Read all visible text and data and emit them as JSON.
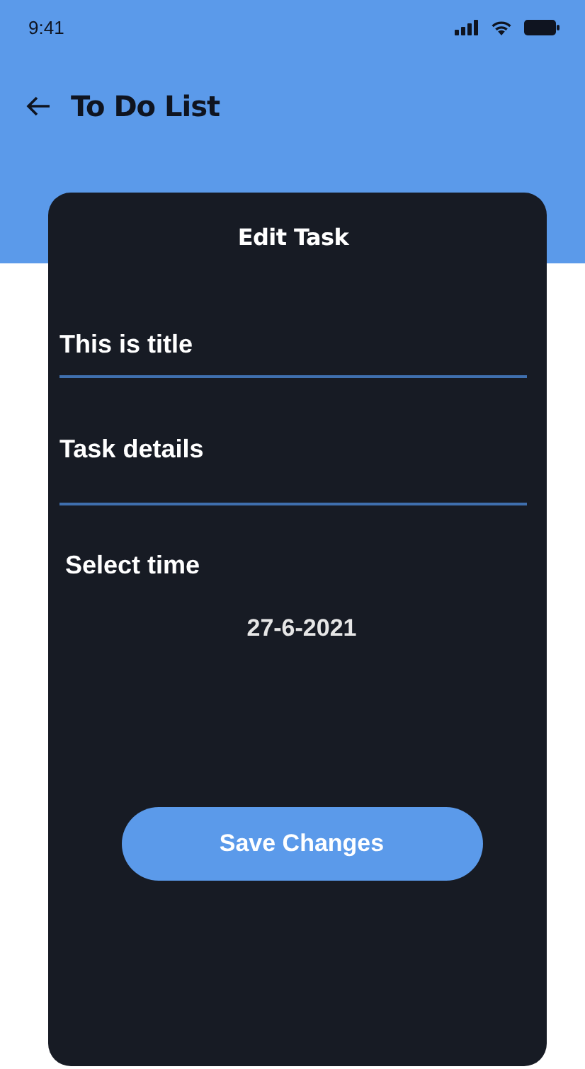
{
  "status_bar": {
    "time": "9:41"
  },
  "header": {
    "title": "To Do List"
  },
  "dialog": {
    "title": "Edit Task",
    "fields": [
      {
        "kind": "line",
        "value": "This is title"
      },
      {
        "kind": "area",
        "placeholder": "Task details"
      }
    ],
    "time_label": "Select time",
    "date": "27-6-2021",
    "button": "Save Changes"
  }
}
